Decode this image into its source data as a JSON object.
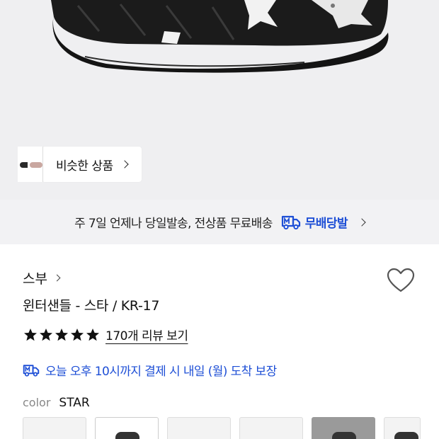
{
  "colors": {
    "accent_blue": "#1e4fd6",
    "hero_bg": "#efeff1",
    "banner_bg": "#f2f2f4"
  },
  "hero": {
    "similar_button": {
      "label": "비슷한 상품",
      "icon": "chevron-right-icon"
    }
  },
  "shipping_banner": {
    "text": "주 7일 언제나 당일발송, 전상품 무료배송",
    "badge_label": "무배당발",
    "badge_icon": "truck-icon"
  },
  "product": {
    "brand": "스부",
    "title": "윈터샌들 - 스타 / KR-17",
    "rating_stars": 5,
    "reviews_link": "170개 리뷰 보기",
    "delivery_text": "오늘 오후 10시까지 결제 시 내일 (월) 도착 보장",
    "color_label": "color",
    "color_value": "STAR",
    "color_options_count": 6
  }
}
